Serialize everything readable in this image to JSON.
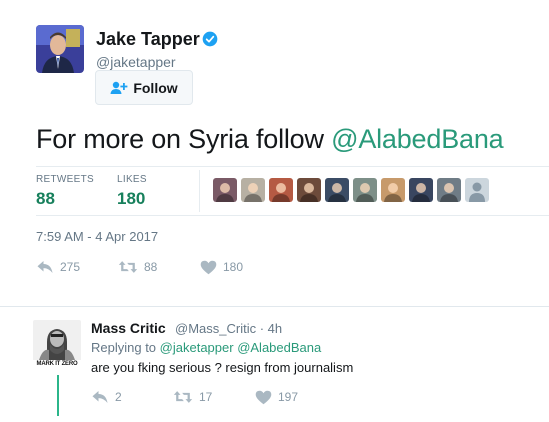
{
  "tweet": {
    "author_name": "Jake Tapper",
    "author_handle": "@jaketapper",
    "follow_label": "Follow",
    "text_prefix": "For more on Syria follow ",
    "text_mention": "@AlabedBana",
    "retweets_label": "RETWEETS",
    "retweets_count": "88",
    "likes_label": "LIKES",
    "likes_count": "180",
    "timestamp": "7:59 AM - 4 Apr 2017",
    "actions": {
      "reply_count": "275",
      "retweet_count": "88",
      "like_count": "180"
    },
    "liker_avatars": [
      {
        "name": "liker-avatar-1",
        "bg": "#7a5a66"
      },
      {
        "name": "liker-avatar-2",
        "bg": "#b7b0a3"
      },
      {
        "name": "liker-avatar-3",
        "bg": "#b55a43"
      },
      {
        "name": "liker-avatar-4",
        "bg": "#6d4b3b"
      },
      {
        "name": "liker-avatar-5",
        "bg": "#3b4c65"
      },
      {
        "name": "liker-avatar-6",
        "bg": "#7d8f88"
      },
      {
        "name": "liker-avatar-7",
        "bg": "#c79a6b"
      },
      {
        "name": "liker-avatar-8",
        "bg": "#394660"
      },
      {
        "name": "liker-avatar-9",
        "bg": "#6f7c86"
      },
      {
        "name": "liker-avatar-10",
        "bg": "#ccd6dd"
      }
    ]
  },
  "reply": {
    "author_name": "Mass Critic",
    "author_handle": "@Mass_Critic · 4h",
    "replying_prefix": "Replying to ",
    "replying_mention_1": "@jaketapper",
    "replying_mention_2": "@AlabedBana",
    "text": "are you fking serious ? resign from journalism",
    "avatar_caption": "MARK IT ZERO",
    "actions": {
      "reply_count": "2",
      "retweet_count": "17",
      "like_count": "197"
    }
  },
  "colors": {
    "accent": "#17805c",
    "mention": "#2a9a7a",
    "muted": "#657786",
    "thread_line": "#2bb58a",
    "verified": "#1da1f2"
  }
}
